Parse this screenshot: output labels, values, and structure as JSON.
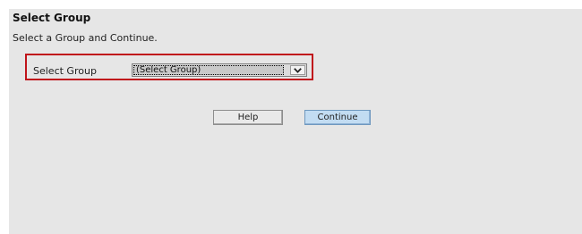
{
  "page": {
    "title": "Select Group",
    "instruction": "Select a Group and Continue."
  },
  "form": {
    "group_label": "Select Group",
    "group_select": {
      "selected_value": "(Select Group)"
    }
  },
  "buttons": {
    "help_label": "Help",
    "continue_label": "Continue"
  },
  "colors": {
    "panel_background": "#e6e6e6",
    "highlight_border": "#c0141b",
    "continue_button": "#c2dcf2"
  }
}
